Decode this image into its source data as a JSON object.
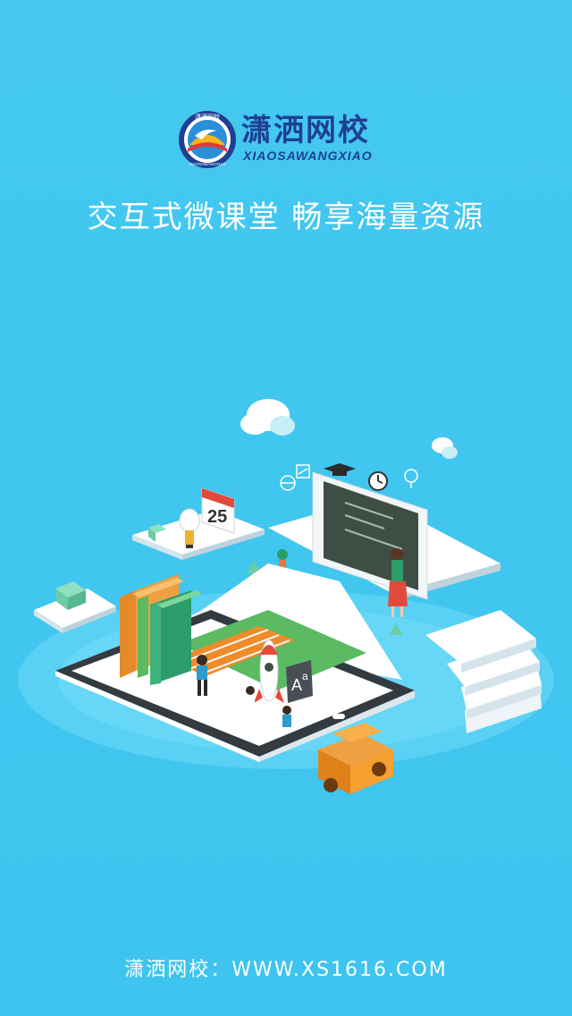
{
  "brand": {
    "name_cn": "潇洒网校",
    "name_en": "XIAOSAWANGXIAO",
    "emblem_text_top": "潇洒网校",
    "emblem_text_bottom": "XIAOSAWANGXIAO"
  },
  "slogan": "交互式微课堂  畅享海量资源",
  "illustration": {
    "calendar_day": "25",
    "font_tile_text": "A",
    "font_tile_sup": "a"
  },
  "footer": "潇洒网校：WWW.XS1616.COM",
  "colors": {
    "background": "#40c6ef",
    "brand_blue": "#1e3f93",
    "white": "#ffffff",
    "orange": "#f0a020"
  }
}
